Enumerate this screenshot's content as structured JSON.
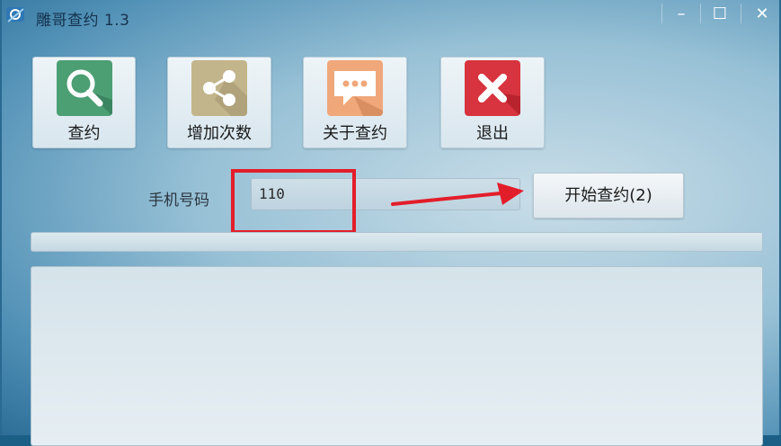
{
  "window": {
    "title": "雕哥查约 1.3",
    "controls": {
      "minimize": "–",
      "maximize": "☐",
      "close": "✕"
    }
  },
  "toolbar": {
    "buttons": [
      {
        "label": "查约",
        "icon": "search-icon",
        "color": "#4c9e73"
      },
      {
        "label": "增加次数",
        "icon": "share-icon",
        "color": "#c3b58b"
      },
      {
        "label": "关于查约",
        "icon": "chat-bubble-icon",
        "color": "#f0a77a"
      },
      {
        "label": "退出",
        "icon": "close-x-icon",
        "color": "#d7343f"
      }
    ]
  },
  "form": {
    "phone_label": "手机号码",
    "phone_value": "110",
    "start_button": "开始查约(2)"
  },
  "annotation": {
    "highlight_color": "#e21e2a"
  }
}
